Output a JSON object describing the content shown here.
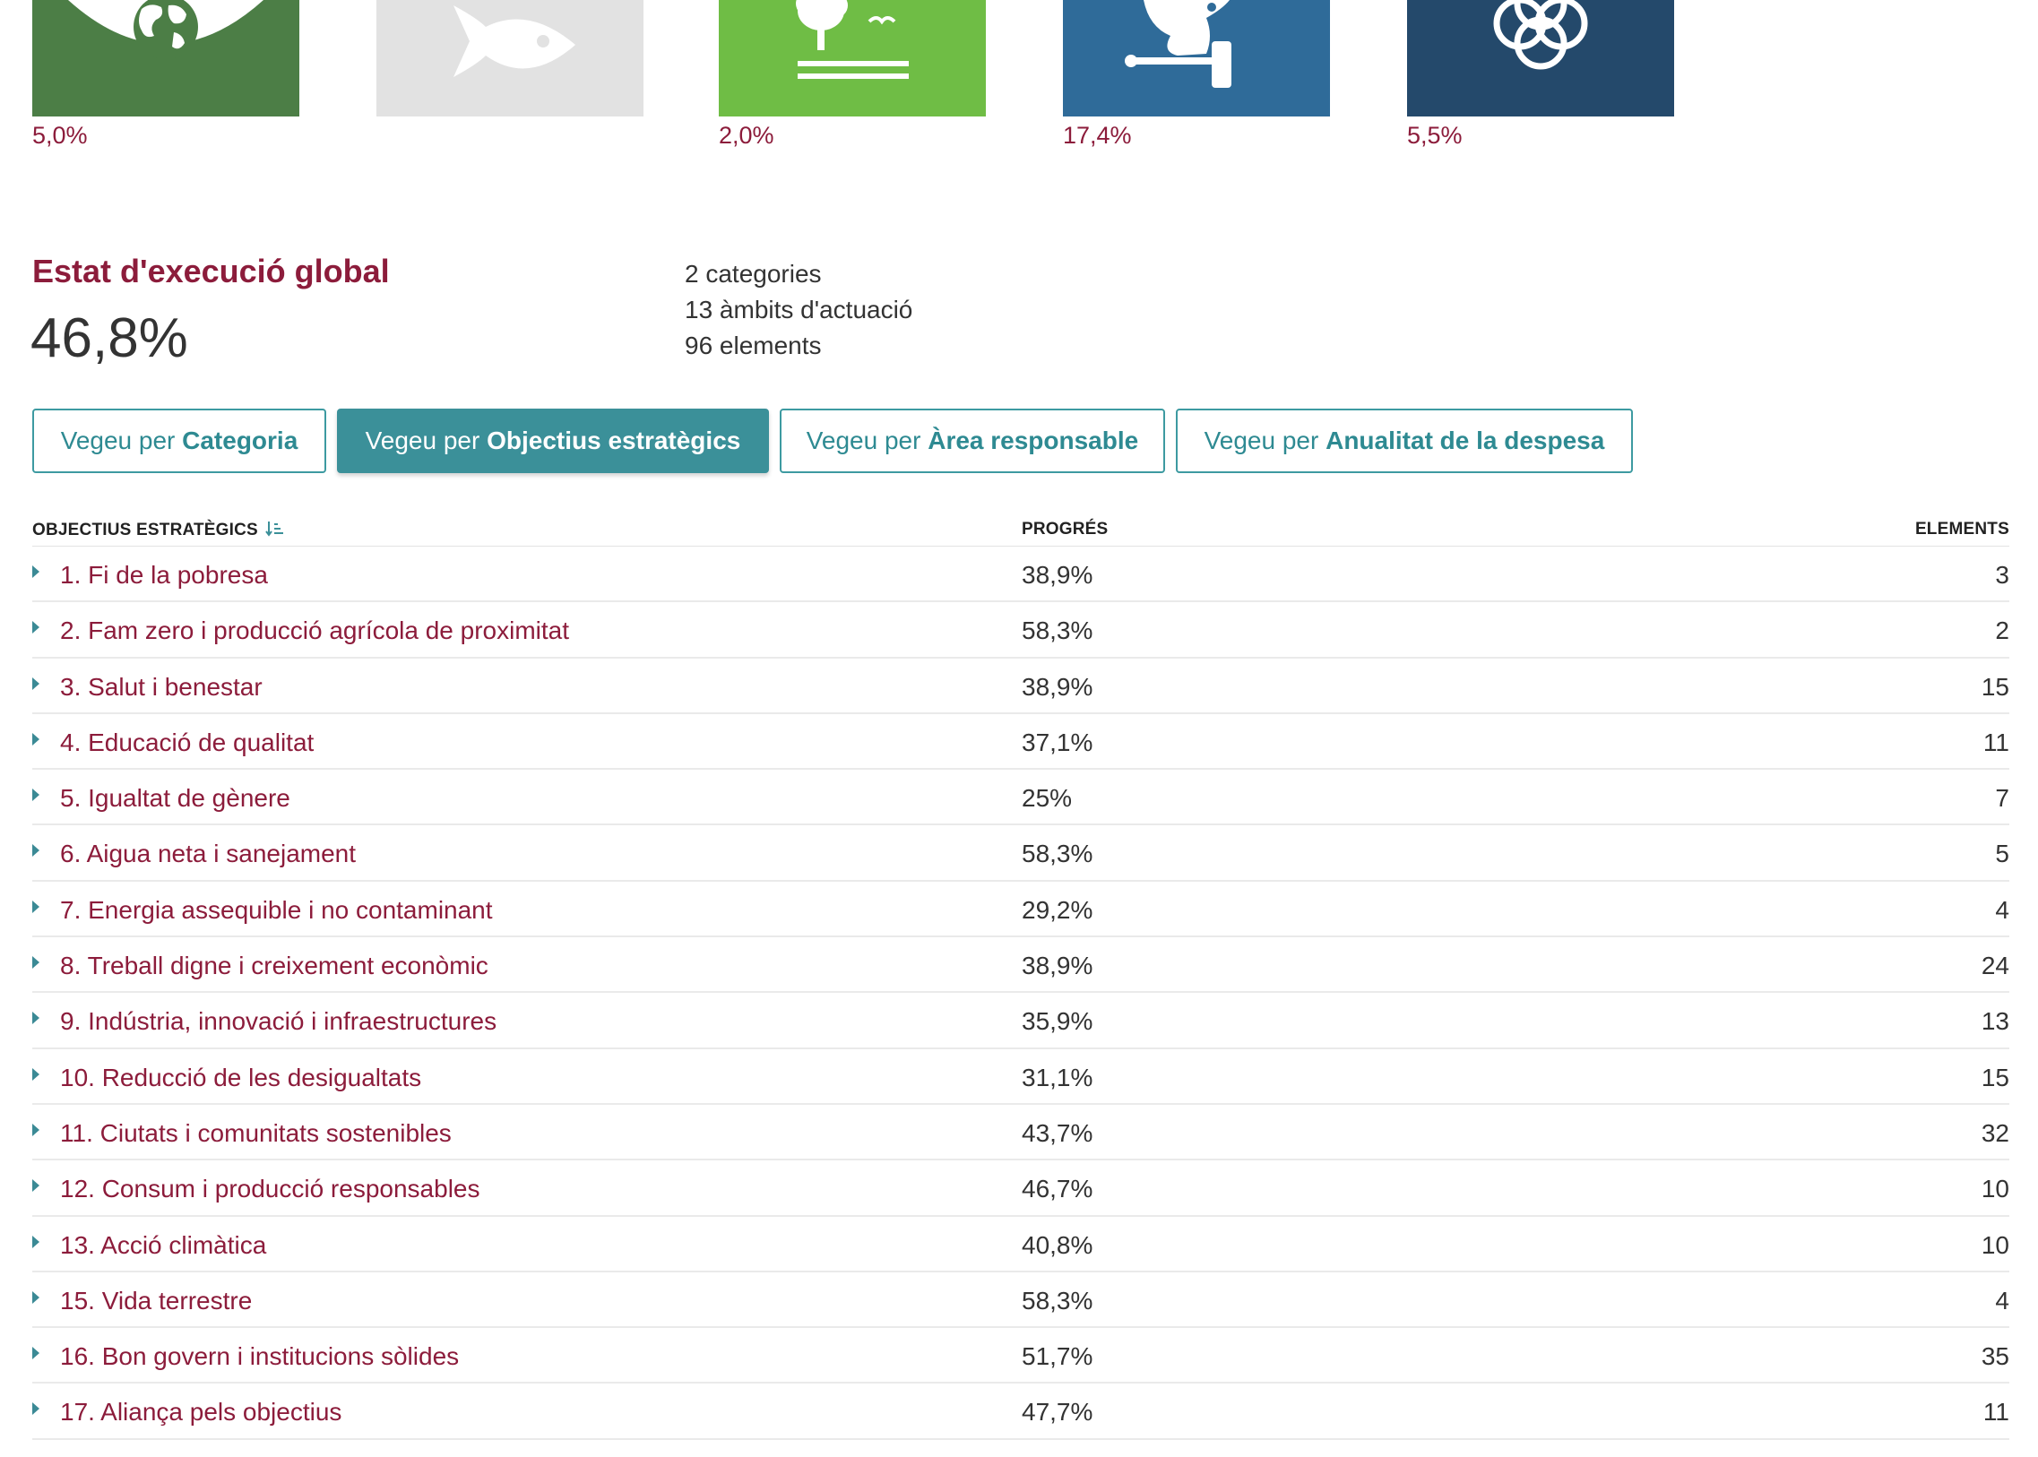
{
  "colors": {
    "accent_maroon": "#8c1c3b",
    "accent_teal": "#3b9099",
    "sdg_green_dark": "#4c7e46",
    "sdg_grey_inactive": "#e2e2e2",
    "sdg_green_light": "#6fbd45",
    "sdg_blue": "#2f6b99",
    "sdg_navy": "#24496b"
  },
  "sdg_tiles": [
    {
      "icon": "eye-globe-icon",
      "color": "#4c7e46",
      "percent": "5,0%"
    },
    {
      "icon": "fish-icon",
      "color": "#e2e2e2",
      "percent": ""
    },
    {
      "icon": "tree-bird-icon",
      "color": "#6fbd45",
      "percent": "2,0%"
    },
    {
      "icon": "dove-gavel-icon",
      "color": "#2f6b99",
      "percent": "17,4%"
    },
    {
      "icon": "flower-rings-icon",
      "color": "#24496b",
      "percent": "5,5%"
    }
  ],
  "summary": {
    "title": "Estat d'execució global",
    "value": "46,8%",
    "stats": [
      "2 categories",
      "13 àmbits d'actuació",
      "96 elements"
    ]
  },
  "view_buttons": [
    {
      "prefix": "Vegeu per ",
      "label": "Categoria",
      "active": false
    },
    {
      "prefix": "Vegeu per ",
      "label": "Objectius estratègics",
      "active": true
    },
    {
      "prefix": "Vegeu per ",
      "label": "Àrea responsable",
      "active": false
    },
    {
      "prefix": "Vegeu per ",
      "label": "Anualitat de la despesa",
      "active": false
    }
  ],
  "table": {
    "headers": {
      "name": "OBJECTIUS ESTRATÈGICS",
      "progress": "PROGRÉS",
      "elements": "ELEMENTS"
    },
    "rows": [
      {
        "name": "1. Fi de la pobresa",
        "progress": "38,9%",
        "elements": "3"
      },
      {
        "name": "2. Fam zero i producció agrícola de proximitat",
        "progress": "58,3%",
        "elements": "2"
      },
      {
        "name": "3. Salut i benestar",
        "progress": "38,9%",
        "elements": "15"
      },
      {
        "name": "4. Educació de qualitat",
        "progress": "37,1%",
        "elements": "11"
      },
      {
        "name": "5. Igualtat de gènere",
        "progress": "25%",
        "elements": "7"
      },
      {
        "name": "6. Aigua neta i sanejament",
        "progress": "58,3%",
        "elements": "5"
      },
      {
        "name": "7. Energia assequible i no contaminant",
        "progress": "29,2%",
        "elements": "4"
      },
      {
        "name": "8. Treball digne i creixement econòmic",
        "progress": "38,9%",
        "elements": "24"
      },
      {
        "name": "9. Indústria, innovació i infraestructures",
        "progress": "35,9%",
        "elements": "13"
      },
      {
        "name": "10. Reducció de les desigualtats",
        "progress": "31,1%",
        "elements": "15"
      },
      {
        "name": "11. Ciutats i comunitats sostenibles",
        "progress": "43,7%",
        "elements": "32"
      },
      {
        "name": "12. Consum i producció responsables",
        "progress": "46,7%",
        "elements": "10"
      },
      {
        "name": "13. Acció climàtica",
        "progress": "40,8%",
        "elements": "10"
      },
      {
        "name": "15. Vida terrestre",
        "progress": "58,3%",
        "elements": "4"
      },
      {
        "name": "16. Bon govern i institucions sòlides",
        "progress": "51,7%",
        "elements": "35"
      },
      {
        "name": "17. Aliança pels objectius",
        "progress": "47,7%",
        "elements": "11"
      }
    ]
  }
}
